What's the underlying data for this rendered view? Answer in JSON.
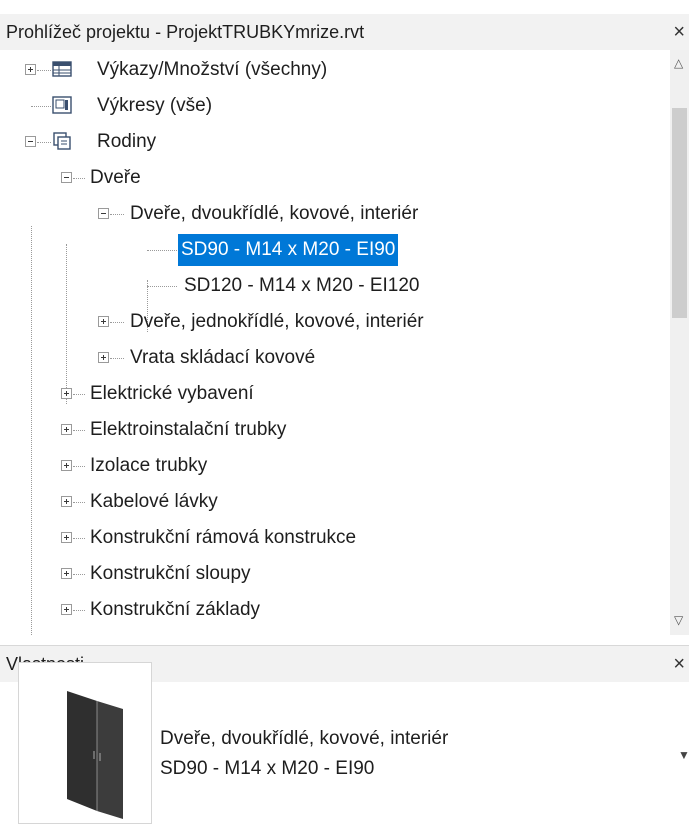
{
  "project_browser": {
    "title": "Prohlížeč projektu - ProjektTRUBKYmrize.rvt",
    "close": "×",
    "items": [
      {
        "label": "Výkazy/Množství (všechny)",
        "icon": "schedule-icon",
        "expander": "plus"
      },
      {
        "label": "Výkresy (vše)",
        "icon": "sheet-icon",
        "expander": "none"
      },
      {
        "label": "Rodiny",
        "icon": "families-icon",
        "expander": "minus"
      },
      {
        "label": "Dveře",
        "expander": "minus"
      },
      {
        "label": "Dveře, dvoukřídlé, kovové, interiér",
        "expander": "minus"
      },
      {
        "label": "SD90 - M14 x M20 - EI90",
        "expander": "none",
        "selected": true
      },
      {
        "label": "SD120 - M14 x M20 - EI120",
        "expander": "none"
      },
      {
        "label": "Dveře, jednokřídlé, kovové, interiér",
        "expander": "plus"
      },
      {
        "label": "Vrata skládací kovové",
        "expander": "plus"
      },
      {
        "label": "Elektrické vybavení",
        "expander": "plus"
      },
      {
        "label": "Elektroinstalační trubky",
        "expander": "plus"
      },
      {
        "label": "Izolace trubky",
        "expander": "plus"
      },
      {
        "label": "Kabelové lávky",
        "expander": "plus"
      },
      {
        "label": "Konstrukční rámová konstrukce",
        "expander": "plus"
      },
      {
        "label": "Konstrukční sloupy",
        "expander": "plus"
      },
      {
        "label": "Konstrukční základy",
        "expander": "plus"
      }
    ]
  },
  "properties": {
    "title": "Vlastnosti",
    "close": "×",
    "type_family": "Dveře, dvoukřídlé, kovové, interiér",
    "type_name": "SD90 - M14 x M20 - EI90",
    "preview_icon": "double-door-icon"
  },
  "colors": {
    "selection": "#0078d7",
    "header_bg": "#f2f2f2"
  }
}
